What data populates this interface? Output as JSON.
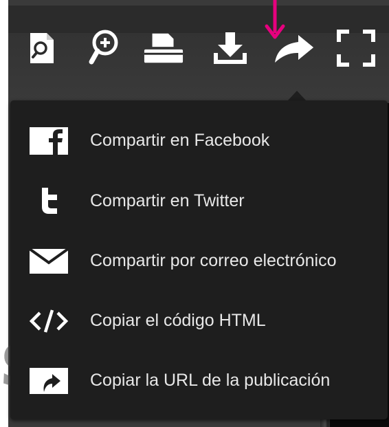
{
  "toolbar": {
    "buttons": [
      {
        "name": "document-search-icon"
      },
      {
        "name": "zoom-in-icon"
      },
      {
        "name": "print-icon"
      },
      {
        "name": "download-icon"
      },
      {
        "name": "share-icon"
      },
      {
        "name": "fullscreen-icon"
      }
    ]
  },
  "annotation": {
    "color": "#e6007e",
    "icon": "arrow-down-icon"
  },
  "share_menu": {
    "items": [
      {
        "label": "Compartir en Facebook",
        "icon": "facebook-icon"
      },
      {
        "label": "Compartir en Twitter",
        "icon": "twitter-icon"
      },
      {
        "label": "Compartir por correo electrónico",
        "icon": "envelope-icon"
      },
      {
        "label": "Copiar el código HTML",
        "icon": "code-icon"
      },
      {
        "label": "Copiar la URL de la publicación",
        "icon": "link-arrow-icon"
      }
    ]
  },
  "background_text": "siesta",
  "colors": {
    "menu_bg": "#1e1e1e",
    "toolbar_bg": "#2b2b2b",
    "icon": "#ffffff",
    "label": "#e8e8e8"
  }
}
